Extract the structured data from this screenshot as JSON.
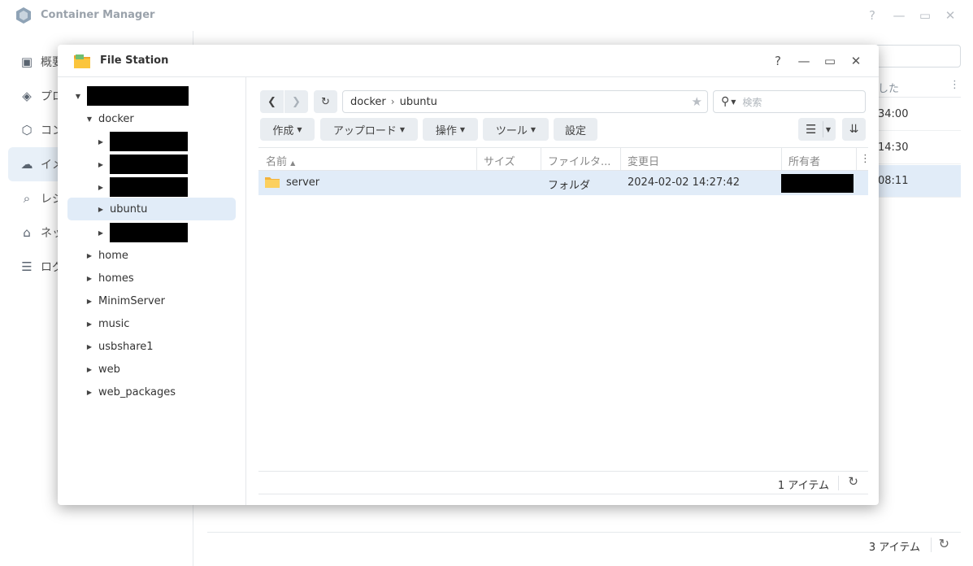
{
  "background_app": {
    "title": "Container Manager",
    "window_buttons": {
      "help": "?",
      "minimize": "—",
      "maximize": "▭",
      "close": "✕"
    },
    "sidebar": [
      {
        "label": "概要",
        "icon": "dashboard-icon"
      },
      {
        "label": "プロ",
        "icon": "layers-icon"
      },
      {
        "label": "コン",
        "icon": "cube-icon"
      },
      {
        "label": "イメ",
        "icon": "cloud-icon",
        "active": true
      },
      {
        "label": "レジ",
        "icon": "registry-search-icon"
      },
      {
        "label": "ネッ",
        "icon": "network-icon"
      },
      {
        "label": "ログ",
        "icon": "log-list-icon"
      }
    ],
    "table_header_partial": "した",
    "rows_partial": [
      "34:00",
      "14:30",
      "08:11"
    ],
    "footer_count": "3 アイテム"
  },
  "file_station": {
    "title": "File Station",
    "window_buttons": {
      "help": "?",
      "minimize": "—",
      "maximize": "▭",
      "close": "✕"
    },
    "tree": {
      "root_redacted": true,
      "docker": "docker",
      "ubuntu": "ubuntu",
      "shares": [
        "home",
        "homes",
        "MinimServer",
        "music",
        "usbshare1",
        "web",
        "web_packages"
      ]
    },
    "path": [
      "docker",
      "ubuntu"
    ],
    "search_placeholder": "検索",
    "toolbar": {
      "create": "作成",
      "upload": "アップロード",
      "action": "操作",
      "tools": "ツール",
      "settings": "設定"
    },
    "columns": {
      "name": "名前",
      "size": "サイズ",
      "filetype": "ファイルタ...",
      "modified": "変更日",
      "owner": "所有者"
    },
    "files": [
      {
        "name": "server",
        "size": "",
        "type": "フォルダ",
        "modified": "2024-02-02 14:27:42",
        "owner_redacted": true
      }
    ],
    "footer_count": "1 アイテム"
  }
}
